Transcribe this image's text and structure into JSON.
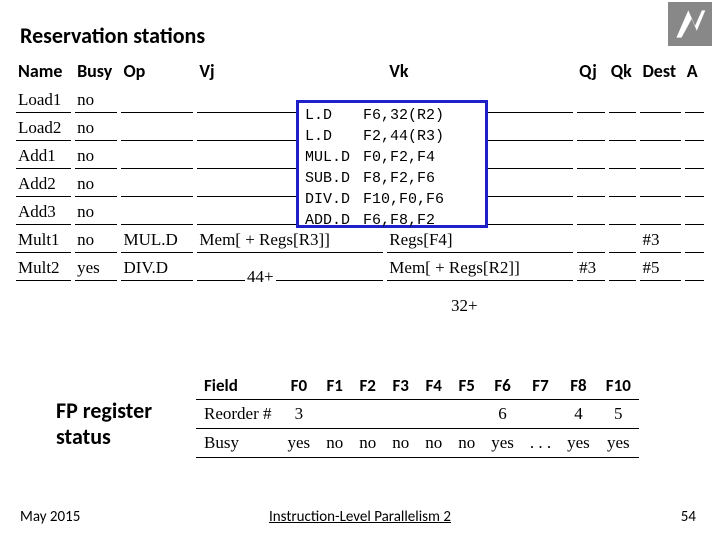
{
  "title": "Reservation stations",
  "rs": {
    "headers": {
      "name": "Name",
      "busy": "Busy",
      "op": "Op",
      "vj": "Vj",
      "vk": "Vk",
      "qj": "Qj",
      "qk": "Qk",
      "dest": "Dest",
      "a": "A"
    },
    "rows": [
      {
        "name": "Load1",
        "busy": "no",
        "op": "",
        "vj": "",
        "vk": "",
        "qj": "",
        "qk": "",
        "dest": "",
        "a": ""
      },
      {
        "name": "Load2",
        "busy": "no",
        "op": "",
        "vj": "",
        "vk": "",
        "qj": "",
        "qk": "",
        "dest": "",
        "a": ""
      },
      {
        "name": "Add1",
        "busy": "no",
        "op": "",
        "vj": "",
        "vk": "",
        "qj": "",
        "qk": "",
        "dest": "",
        "a": ""
      },
      {
        "name": "Add2",
        "busy": "no",
        "op": "",
        "vj": "",
        "vk": "",
        "qj": "",
        "qk": "",
        "dest": "",
        "a": ""
      },
      {
        "name": "Add3",
        "busy": "no",
        "op": "",
        "vj": "",
        "vk": "",
        "qj": "",
        "qk": "",
        "dest": "",
        "a": ""
      },
      {
        "name": "Mult1",
        "busy": "no",
        "op": "MUL.D",
        "vj": "Mem[     + Regs[R3]]",
        "vk": "Regs[F4]",
        "qj": "",
        "qk": "",
        "dest": "#3",
        "a": ""
      },
      {
        "name": "Mult2",
        "busy": "yes",
        "op": "DIV.D",
        "vj": "",
        "vk": "Mem[     + Regs[R2]]",
        "qj": "#3",
        "qk": "",
        "dest": "#5",
        "a": ""
      }
    ]
  },
  "overlay44": "44+",
  "overlay32": "32+",
  "instructions": [
    {
      "op": "L.D",
      "args": "F6,32(R2)"
    },
    {
      "op": "L.D",
      "args": "F2,44(R3)"
    },
    {
      "op": "MUL.D",
      "args": "F0,F2,F4"
    },
    {
      "op": "SUB.D",
      "args": "F8,F2,F6"
    },
    {
      "op": "DIV.D",
      "args": "F10,F0,F6"
    },
    {
      "op": "ADD.D",
      "args": "F6,F8,F2"
    }
  ],
  "fp_label_l1": "FP register",
  "fp_label_l2": "status",
  "fp": {
    "field_label": "Field",
    "cols": [
      "F0",
      "F1",
      "F2",
      "F3",
      "F4",
      "F5",
      "F6",
      "F7",
      "F8",
      "F10"
    ],
    "reorder_label": "Reorder #",
    "reorder": [
      "3",
      "",
      "",
      "",
      "",
      "",
      "6",
      "",
      "4",
      "5"
    ],
    "busy_label": "Busy",
    "busy": [
      "yes",
      "no",
      "no",
      "no",
      "no",
      "no",
      "yes",
      ". . .",
      "yes",
      "yes"
    ]
  },
  "footer": {
    "date": "May 2015",
    "course": "Instruction-Level Parallelism 2",
    "page": "54"
  }
}
